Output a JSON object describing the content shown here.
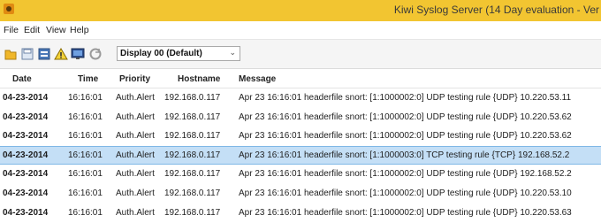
{
  "window": {
    "title": "Kiwi Syslog Server (14 Day evaluation - Ver"
  },
  "menu": {
    "items": [
      "File",
      "Edit",
      "View",
      "Help"
    ]
  },
  "toolbar": {
    "display_select": "Display 00 (Default)"
  },
  "table": {
    "columns": [
      "Date",
      "Time",
      "Priority",
      "Hostname",
      "Message"
    ],
    "rows": [
      {
        "date": "04-23-2014",
        "time": "16:16:01",
        "priority": "Auth.Alert",
        "host": "192.168.0.117",
        "msg": "Apr 23 16:16:01 headerfile snort: [1:1000002:0] UDP testing rule {UDP} 10.220.53.11"
      },
      {
        "date": "04-23-2014",
        "time": "16:16:01",
        "priority": "Auth.Alert",
        "host": "192.168.0.117",
        "msg": "Apr 23 16:16:01 headerfile snort: [1:1000002:0] UDP testing rule {UDP} 10.220.53.62"
      },
      {
        "date": "04-23-2014",
        "time": "16:16:01",
        "priority": "Auth.Alert",
        "host": "192.168.0.117",
        "msg": "Apr 23 16:16:01 headerfile snort: [1:1000002:0] UDP testing rule {UDP} 10.220.53.62"
      },
      {
        "date": "04-23-2014",
        "time": "16:16:01",
        "priority": "Auth.Alert",
        "host": "192.168.0.117",
        "msg": "Apr 23 16:16:01 headerfile snort: [1:1000003:0] TCP testing rule {TCP} 192.168.52.2"
      },
      {
        "date": "04-23-2014",
        "time": "16:16:01",
        "priority": "Auth.Alert",
        "host": "192.168.0.117",
        "msg": "Apr 23 16:16:01 headerfile snort: [1:1000002:0] UDP testing rule {UDP} 192.168.52.2"
      },
      {
        "date": "04-23-2014",
        "time": "16:16:01",
        "priority": "Auth.Alert",
        "host": "192.168.0.117",
        "msg": "Apr 23 16:16:01 headerfile snort: [1:1000002:0] UDP testing rule {UDP} 10.220.53.10"
      },
      {
        "date": "04-23-2014",
        "time": "16:16:01",
        "priority": "Auth.Alert",
        "host": "192.168.0.117",
        "msg": "Apr 23 16:16:01 headerfile snort: [1:1000002:0] UDP testing rule {UDP} 10.220.53.63"
      }
    ],
    "selected_row": 3
  },
  "colors": {
    "titlebar": "#f2c531",
    "selected_row": "#c4dff6"
  },
  "icons": [
    "kiwi-app-icon",
    "open-icon",
    "save-icon",
    "clear-icon",
    "alert-icon",
    "monitor-icon",
    "refresh-icon"
  ]
}
